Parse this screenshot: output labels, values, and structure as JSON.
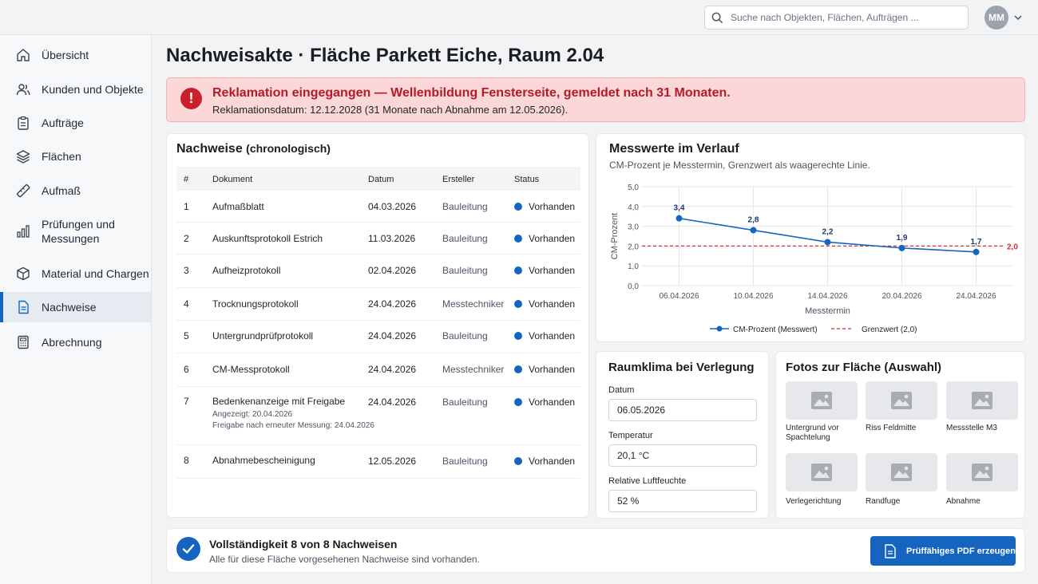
{
  "search": {
    "placeholder": "Suche nach Objekten, Flächen, Aufträgen ..."
  },
  "user": {
    "initials": "MM"
  },
  "sidebar": {
    "items": [
      {
        "label": "Übersicht",
        "icon": "home-icon"
      },
      {
        "label": "Kunden und Objekte",
        "icon": "users-icon"
      },
      {
        "label": "Aufträge",
        "icon": "clipboard-icon"
      },
      {
        "label": "Flächen",
        "icon": "layers-icon"
      },
      {
        "label": "Aufmaß",
        "icon": "ruler-icon"
      },
      {
        "label": "Prüfungen und Messungen",
        "icon": "bar-chart-icon"
      },
      {
        "label": "Material und Chargen",
        "icon": "box-icon"
      },
      {
        "label": "Nachweise",
        "icon": "document-icon",
        "active": true
      },
      {
        "label": "Abrechnung",
        "icon": "calculator-icon"
      }
    ]
  },
  "page": {
    "title": "Nachweisakte · Fläche Parkett Eiche, Raum 2.04"
  },
  "alert": {
    "icon": "!",
    "title": "Reklamation eingegangen — Wellenbildung Fensterseite, gemeldet nach 31 Monaten.",
    "subtitle": "Reklamationsdatum: 12.12.2028 (31 Monate nach Abnahme am 12.05.2026)."
  },
  "proofs": {
    "title": "Nachweise",
    "title_suffix": "(chronologisch)",
    "headers": {
      "num": "#",
      "doc": "Dokument",
      "date": "Datum",
      "by": "Ersteller",
      "status": "Status"
    },
    "rows": [
      {
        "num": "1",
        "doc": "Aufmaßblatt",
        "date": "04.03.2026",
        "by": "Bauleitung",
        "status": "Vorhanden"
      },
      {
        "num": "2",
        "doc": "Auskunftsprotokoll Estrich",
        "date": "11.03.2026",
        "by": "Bauleitung",
        "status": "Vorhanden"
      },
      {
        "num": "3",
        "doc": "Aufheizprotokoll",
        "date": "02.04.2026",
        "by": "Bauleitung",
        "status": "Vorhanden"
      },
      {
        "num": "4",
        "doc": "Trocknungsprotokoll",
        "date": "24.04.2026",
        "by": "Messtechniker",
        "status": "Vorhanden"
      },
      {
        "num": "5",
        "doc": "Untergrundprüfprotokoll",
        "date": "24.04.2026",
        "by": "Bauleitung",
        "status": "Vorhanden"
      },
      {
        "num": "6",
        "doc": "CM-Messprotokoll",
        "date": "24.04.2026",
        "by": "Messtechniker",
        "status": "Vorhanden"
      },
      {
        "num": "7",
        "doc": "Bedenkenanzeige mit Freigabe",
        "date": "24.04.2026",
        "by": "Bauleitung",
        "status": "Vorhanden",
        "extra1": "Angezeigt: 20.04.2026",
        "extra2": "Freigabe nach erneuter Messung: 24.04.2026"
      },
      {
        "num": "8",
        "doc": "Abnahmebescheinigung",
        "date": "12.05.2026",
        "by": "Bauleitung",
        "status": "Vorhanden"
      }
    ]
  },
  "chart_data": {
    "type": "line",
    "title": "Messwerte im Verlauf",
    "subtitle": "CM-Prozent je Messtermin, Grenzwert als waagerechte Linie.",
    "xlabel": "Messtermin",
    "ylabel": "CM-Prozent",
    "x_ticks": [
      "06.04.2026",
      "10.04.2026",
      "14.04.2026",
      "20.04.2026",
      "24.04.2026"
    ],
    "y_ticks": [
      "0,0",
      "1,0",
      "2,0",
      "3,0",
      "4,0",
      "5,0"
    ],
    "ylim": [
      0,
      5
    ],
    "grid": true,
    "legend": "bottom",
    "series": [
      {
        "name": "CM-Prozent (Messwert)",
        "color": "#1565c0",
        "x": [
          "06.04.2026",
          "10.04.2026",
          "14.04.2026",
          "20.04.2026",
          "24.04.2026"
        ],
        "values": [
          3.4,
          2.8,
          2.2,
          1.9,
          1.7
        ],
        "labels": [
          "3,4",
          "2,8",
          "2,2",
          "1,9",
          "1,7"
        ]
      }
    ],
    "threshold": {
      "name": "Grenzwert (2,0)",
      "value": 2.0,
      "label": "2,0",
      "color": "#d32f2f"
    }
  },
  "climate": {
    "title": "Raumklima bei Verlegung",
    "date_label": "Datum",
    "date_value": "06.05.2026",
    "temp_label": "Temperatur",
    "temp_value": "20,1 °C",
    "humidity_label": "Relative Luftfeuchte",
    "humidity_value": "52 %"
  },
  "photos": {
    "title": "Fotos zur Fläche (Auswahl)",
    "items": [
      {
        "caption": "Untergrund vor Spachtelung"
      },
      {
        "caption": "Riss Feldmitte"
      },
      {
        "caption": "Messstelle M3"
      },
      {
        "caption": "Verlegerichtung"
      },
      {
        "caption": "Randfuge"
      },
      {
        "caption": "Abnahme"
      }
    ]
  },
  "footer": {
    "title": "Vollständigkeit 8 von 8 Nachweisen",
    "subtitle": "Alle für diese Fläche vorgesehenen Nachweise sind vorhanden.",
    "pdf_label": "Prüffähiges PDF erzeugen"
  }
}
